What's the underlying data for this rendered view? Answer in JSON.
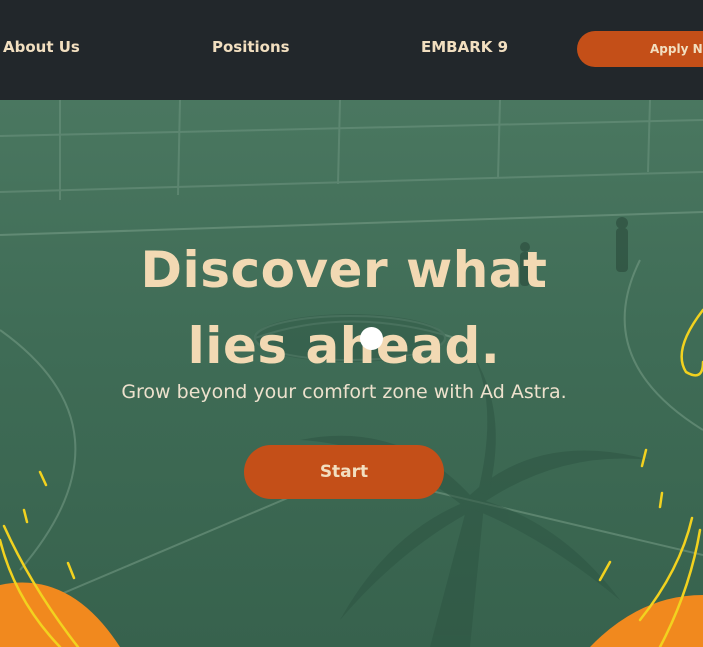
{
  "nav": {
    "links": [
      {
        "label": "About Us"
      },
      {
        "label": "Positions"
      },
      {
        "label": "EMBARK 9"
      }
    ],
    "apply_label": "Apply Now"
  },
  "hero": {
    "headline_line1": "Discover what",
    "headline_line2": "lies ahead.",
    "subtitle": "Grow beyond your comfort zone with Ad Astra.",
    "cta_label": "Start"
  },
  "colors": {
    "nav_background": "#22272b",
    "hero_green": "#3f6a54",
    "accent_orange": "#c44f18",
    "headline_cream": "#f2d9b3",
    "doodle_yellow": "#f2d21f",
    "blob_orange": "#f1891e"
  },
  "icons": [
    "cursor-indicator-icon"
  ]
}
